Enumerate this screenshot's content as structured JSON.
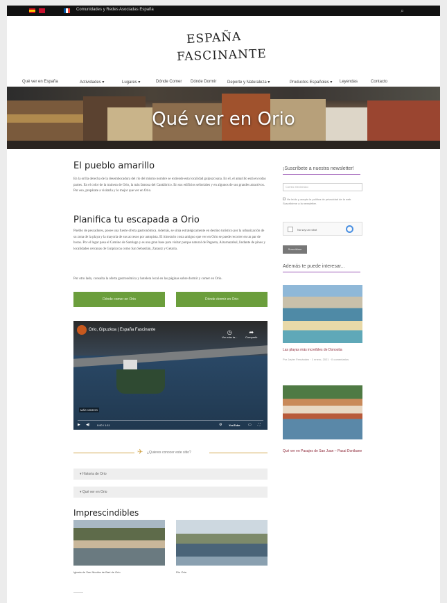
{
  "topbar": {
    "tagline": "Comunidades y Redes Asociadas España"
  },
  "logo": {
    "line1": "ESPAÑA",
    "line2": "FASCINANTE"
  },
  "nav": {
    "items": [
      {
        "label": "Qué ver en España"
      },
      {
        "label": "Actividades ▾"
      },
      {
        "label": "Lugares ▾"
      },
      {
        "label": "Dónde Comer"
      },
      {
        "label": "Dónde Dormir"
      },
      {
        "label": "Deporte y Naturaleza ▾"
      },
      {
        "label": "Productos Españoles ▾"
      },
      {
        "label": "Leyendas"
      },
      {
        "label": "Contacto"
      }
    ]
  },
  "hero": {
    "title": "Qué ver en Orio"
  },
  "article": {
    "h_pueblo": "El pueblo amarillo",
    "p1": "En la orilla derecha de la desembocadura del río del mismo nombre se extiende esta localidad guipuzcoana. En él, el amarillo está en todas partes. En el color de la trainera de Orio, la más famosa del Cantábrico. En sus edificios señoriales y en algunos de sus grandes atractivos. Por eso, prepárate a visitarla y lo mejor que ver en Orio.",
    "h_planifica": "Planifica tu escapada a Orio",
    "p2": "Pueblo de pescadores, posee una fuerte oferta gastronómica. Además, se sitúa estratégicamente en destino turístico por la urbanización de su zona de la playa y la mayoría de sus accesos por autopista. El itinerario costa antiguo que ver en Orio se puede recorrer en un par de horas. Por el lugar pasa el Camino de Santiago y es una gran base para visitar parque natural de Pagoeta, Aizarnazabal, lindante de pinos y localidades cercanas de Guipúzcoa como San Sebastián, Zarautz y Getaria.",
    "p3": "Por otro lado, consulta la oferta gastronómica y hotelera local en las páginas sobre dormir y comer en Orio.",
    "btn_left": "Dónde comer en Orio",
    "btn_right": "Dónde dormir en Orio"
  },
  "video": {
    "title": "Orio, Gipuzkoa | España Fascinante",
    "watch_later": "Ver más ta...",
    "share": "Compartir",
    "more_videos": "MÁS VIDEOS",
    "time": "0:00 / 1:11",
    "youtube": "YouTube"
  },
  "divider": {
    "text": "¿Quieres conocer este sitio?"
  },
  "accordion": [
    {
      "label": "▾  Historia de Orio"
    },
    {
      "label": "▾  Qué ver en Orio"
    }
  ],
  "imprescindibles": {
    "heading": "Imprescindibles",
    "items": [
      {
        "caption": "Iglesia de San Nicolás de Bari de Orio"
      },
      {
        "caption": "Río Oria"
      }
    ]
  },
  "sidebar": {
    "newsletter_heading": "¡Suscríbete a nuestra newsletter!",
    "email_placeholder": "Correo electrónico",
    "consent": "He leído y acepto la política de privacidad de la web. Suscribirme a la newsletter.",
    "recaptcha_label": "No soy un robot",
    "subscribe_label": "Suscribirse",
    "related_heading": "Además te puede interesar...",
    "related": [
      {
        "title": "Las playas más increíbles de Donostia",
        "meta": "Por Javier Fernández · 1 enero, 2021 · 0 comentarios"
      },
      {
        "title": "Qué ver en Pasajes de San Juan – Pasai Donibane"
      }
    ]
  },
  "colors": {
    "accent_green": "#6b9e3c",
    "accent_purple": "#9b59b6",
    "link_maroon": "#8e2a3a",
    "divider_gold": "#d2a64d"
  }
}
